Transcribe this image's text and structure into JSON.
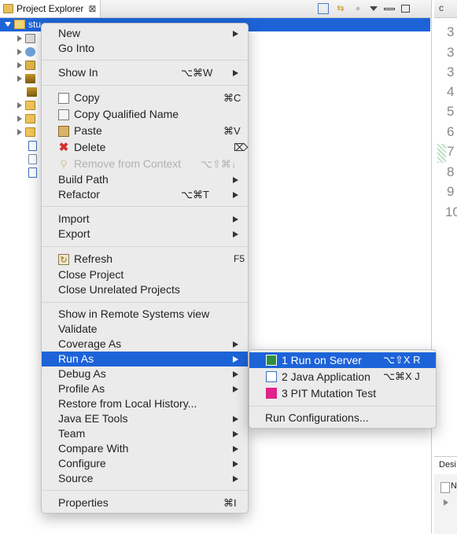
{
  "project_explorer": {
    "tab_label": "Project Explorer",
    "close_glyph": "⊠",
    "selected_item": "stu",
    "toolbar_icons": [
      "collapse-all-icon",
      "link-with-editor-icon",
      "filter-icon",
      "view-menu-icon",
      "minimize-icon",
      "maximize-icon"
    ]
  },
  "editor": {
    "tab_glyph": "c",
    "line_numbers": [
      "3",
      "3",
      "3",
      "4",
      "5",
      "6",
      "7",
      "8",
      "9",
      "10"
    ],
    "bottom_tab_label": "Desi",
    "bottom_row_label": "N"
  },
  "context_menu": {
    "new": "New",
    "go_into": "Go Into",
    "show_in": "Show In",
    "show_in_shortcut": "⌥⌘W",
    "copy": "Copy",
    "copy_shortcut": "⌘C",
    "copy_qualified_name": "Copy Qualified Name",
    "paste": "Paste",
    "paste_shortcut": "⌘V",
    "delete": "Delete",
    "delete_shortcut": "⌦",
    "remove_from_context": "Remove from Context",
    "remove_from_context_shortcut": "⌥⇧⌘↓",
    "build_path": "Build Path",
    "refactor": "Refactor",
    "refactor_shortcut": "⌥⌘T",
    "import": "Import",
    "export": "Export",
    "refresh": "Refresh",
    "refresh_shortcut": "F5",
    "close_project": "Close Project",
    "close_unrelated_projects": "Close Unrelated Projects",
    "show_in_remote_systems_view": "Show in Remote Systems view",
    "validate": "Validate",
    "coverage_as": "Coverage As",
    "run_as": "Run As",
    "debug_as": "Debug As",
    "profile_as": "Profile As",
    "restore_from_local_history": "Restore from Local History...",
    "java_ee_tools": "Java EE Tools",
    "team": "Team",
    "compare_with": "Compare With",
    "configure": "Configure",
    "source": "Source",
    "properties": "Properties",
    "properties_shortcut": "⌘I"
  },
  "run_as_submenu": {
    "run_on_server": "1 Run on Server",
    "run_on_server_shortcut": "⌥⇧X R",
    "java_application": "2 Java Application",
    "java_application_shortcut": "⌥⌘X J",
    "pit_mutation_test": "3 PIT Mutation Test",
    "run_configurations": "Run Configurations..."
  },
  "colors": {
    "selection": "#1d63d8",
    "menu_bg": "#ebebeb",
    "delete_icon": "#d22f2f"
  }
}
